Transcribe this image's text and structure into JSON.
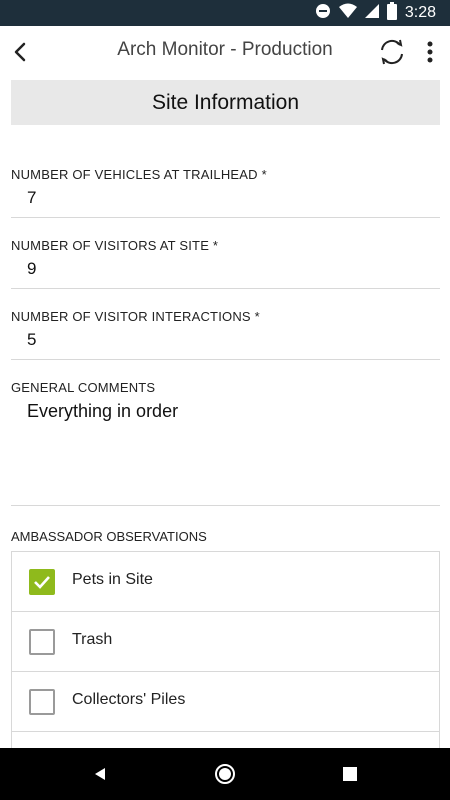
{
  "status_bar": {
    "time": "3:28"
  },
  "app_bar": {
    "title": "Arch Monitor - Production"
  },
  "section": {
    "title": "Site Information"
  },
  "fields": [
    {
      "label": "NUMBER OF VEHICLES AT TRAILHEAD *",
      "value": "7"
    },
    {
      "label": "NUMBER OF VISITORS AT SITE *",
      "value": "9"
    },
    {
      "label": "NUMBER OF VISITOR INTERACTIONS *",
      "value": "5"
    },
    {
      "label": "GENERAL COMMENTS",
      "value": "Everything in order"
    }
  ],
  "observations": {
    "label": "AMBASSADOR OBSERVATIONS",
    "items": [
      {
        "label": "Pets in Site",
        "checked": true
      },
      {
        "label": "Trash",
        "checked": false
      },
      {
        "label": "Collectors' Piles",
        "checked": false
      },
      {
        "label": "",
        "checked": false
      }
    ]
  },
  "colors": {
    "status_bar": "#1e2f3b",
    "checkbox_checked": "#8fba1c",
    "section_bg": "#e8e8e8"
  }
}
